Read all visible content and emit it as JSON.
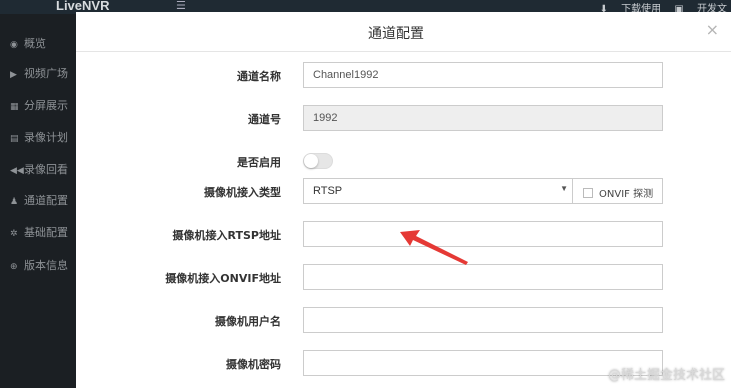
{
  "app": {
    "brand": "LiveNVR",
    "menu_icon": "hamburger-icon"
  },
  "topbar": {
    "download_label": "下载使用",
    "dev_label": "开发文"
  },
  "sidebar": {
    "items": [
      {
        "label": "概览",
        "icon": "dashboard-icon"
      },
      {
        "label": "视频广场",
        "icon": "play-icon"
      },
      {
        "label": "分屏展示",
        "icon": "grid-icon"
      },
      {
        "label": "录像计划",
        "icon": "calendar-icon"
      },
      {
        "label": "录像回看",
        "icon": "rewind-icon"
      },
      {
        "label": "通道配置",
        "icon": "channel-icon"
      },
      {
        "label": "基础配置",
        "icon": "gear-icon"
      },
      {
        "label": "版本信息",
        "icon": "info-icon"
      }
    ]
  },
  "modal": {
    "title": "通道配置",
    "close_label": "×",
    "fields": {
      "channel_name": {
        "label": "通道名称",
        "value": "Channel1992"
      },
      "channel_number": {
        "label": "通道号",
        "value": "1992"
      },
      "enabled": {
        "label": "是否启用",
        "on": false
      },
      "access_type": {
        "label": "摄像机接入类型",
        "value": "RTSP",
        "options": [
          "RTSP"
        ],
        "onvif_probe_label": "ONVIF 探测",
        "onvif_probe_checked": false
      },
      "rtsp_url": {
        "label": "摄像机接入RTSP地址",
        "value": ""
      },
      "onvif_url": {
        "label": "摄像机接入ONVIF地址",
        "value": ""
      },
      "username": {
        "label": "摄像机用户名",
        "value": ""
      },
      "password": {
        "label": "摄像机密码",
        "value": ""
      }
    }
  },
  "annotation": {
    "color": "#e53935",
    "icon": "red-arrow-annotation"
  },
  "watermark": "@稀土掘金技术社区"
}
